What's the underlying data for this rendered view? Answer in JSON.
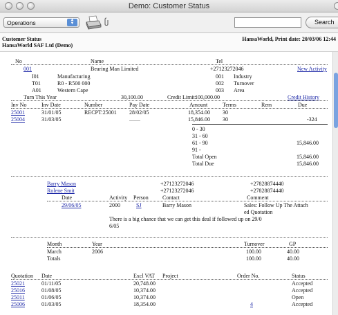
{
  "window": {
    "title": "Demo: Customer Status"
  },
  "toolbar": {
    "select_value": "Operations",
    "search_value": "",
    "search_label": "Search"
  },
  "report_header": {
    "title": "Customer Status",
    "company": "HansaWorld SAF Ltd (Demo)",
    "print_info": "HansaWorld, Print date: 20/03/06 12:44"
  },
  "customer": {
    "col_no": "No",
    "col_name": "Name",
    "col_tel": "Tel",
    "no": "001",
    "name": "Bearing Man Limited",
    "tel": "+27123272046",
    "new_activity": "New Activity",
    "classes": [
      {
        "code": "I01",
        "desc": "Manufacturing",
        "code2": "001",
        "desc2": "Industry"
      },
      {
        "code": "T01",
        "desc": "R0 - R500 000",
        "code2": "002",
        "desc2": "Turnover"
      },
      {
        "code": "A01",
        "desc": "Western Cape",
        "code2": "003",
        "desc2": "Area"
      }
    ],
    "turn_label": "Turn This Year",
    "turn_value": "30,100.00",
    "credit_limit_label": "Credit Limit:",
    "credit_limit_value": "100,000.00",
    "credit_history": "Credit History"
  },
  "invoices": {
    "headers": [
      "Inv No",
      "Inv Date",
      "Number",
      "Pay Date",
      "Amount",
      "Terms",
      "Rem",
      "Due"
    ],
    "rows": [
      [
        "25001",
        "31/01/05",
        "RECPT:25001",
        "28/02/05",
        "18,354.00",
        "30",
        "",
        ""
      ],
      [
        "25004",
        "31/03/05",
        "",
        "........",
        "15,846.00",
        "30",
        "",
        "-324"
      ]
    ],
    "aging": [
      {
        "label": "0 - 30",
        "value": ""
      },
      {
        "label": "31 - 60",
        "value": ""
      },
      {
        "label": "61 - 90",
        "value": "15,846.00"
      },
      {
        "label": "91 -",
        "value": ""
      },
      {
        "label": "Total Open",
        "value": "15,846.00"
      },
      {
        "label": "Total Due",
        "value": "15,846.00"
      }
    ]
  },
  "contacts": [
    {
      "name": "Barry Mason",
      "tel": "+27123272046",
      "mobile": "+27828874440"
    },
    {
      "name": "Rolene Smit",
      "tel": "+27123272046",
      "mobile": "+27828874440"
    }
  ],
  "activity": {
    "headers": {
      "date": "Date",
      "activity": "Activity",
      "person": "Person",
      "contact": "Contact",
      "comment": "Comment"
    },
    "row": {
      "date": "29/06/05",
      "activity": "2000",
      "person": "SJ",
      "contact": "Barry Mason",
      "comment_line1": "Sales: Follow Up The Attach",
      "comment_line2": "ed Quotation"
    },
    "note_line1": "There is a big chance that we can get this deal if followed up on 29/0",
    "note_line2": "6/05"
  },
  "turnover": {
    "headers": {
      "month": "Month",
      "year": "Year",
      "turnover": "Turnover",
      "gp": "GP"
    },
    "row": {
      "month": "March",
      "year": "2006",
      "turnover": "100.00",
      "gp": "40.00"
    },
    "totals": {
      "label": "Totals",
      "turnover": "100.00",
      "gp": "40.00"
    }
  },
  "quotations": {
    "headers": [
      "Quotation",
      "Date",
      "Excl VAT",
      "Project",
      "Order No.",
      "Status"
    ],
    "rows": [
      [
        "25021",
        "01/11/05",
        "20,748.00",
        "",
        "",
        "Accepted"
      ],
      [
        "25016",
        "01/08/05",
        "10,374.00",
        "",
        "",
        "Accepted"
      ],
      [
        "25011",
        "01/06/05",
        "10,374.00",
        "",
        "",
        "Open"
      ],
      [
        "25006",
        "01/03/05",
        "18,354.00",
        "",
        "4",
        "Accepted"
      ]
    ]
  }
}
